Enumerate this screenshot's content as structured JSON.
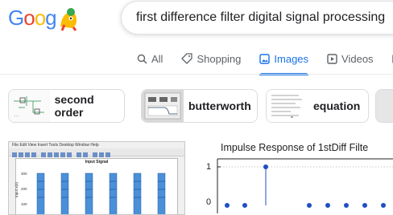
{
  "search": {
    "query": "first difference filter digital signal processing"
  },
  "logo": {
    "text_letters": [
      "G",
      "o",
      "o",
      "g"
    ]
  },
  "tabs": [
    {
      "label": "All",
      "icon": "search-icon",
      "active": false
    },
    {
      "label": "Shopping",
      "icon": "tag-icon",
      "active": false
    },
    {
      "label": "Images",
      "icon": "image-icon",
      "active": true
    },
    {
      "label": "Videos",
      "icon": "play-icon",
      "active": false
    }
  ],
  "chips": [
    {
      "label": "second order"
    },
    {
      "label": "butterworth"
    },
    {
      "label": "equation"
    }
  ],
  "results": {
    "left": {
      "menu_text": "File  Edit  View  Insert  Tools  Desktop  Window  Help",
      "plot_title": "Input Signal",
      "y_ticks": [
        "300",
        "200",
        "100"
      ],
      "y_label": "Input x(n)"
    },
    "right": {
      "plot_title": "Impulse Response of 1stDiff Filte",
      "y_ticks": [
        "1",
        "0"
      ]
    }
  },
  "colors": {
    "accent": "#1a73e8",
    "text": "#202124",
    "muted": "#5f6368"
  }
}
